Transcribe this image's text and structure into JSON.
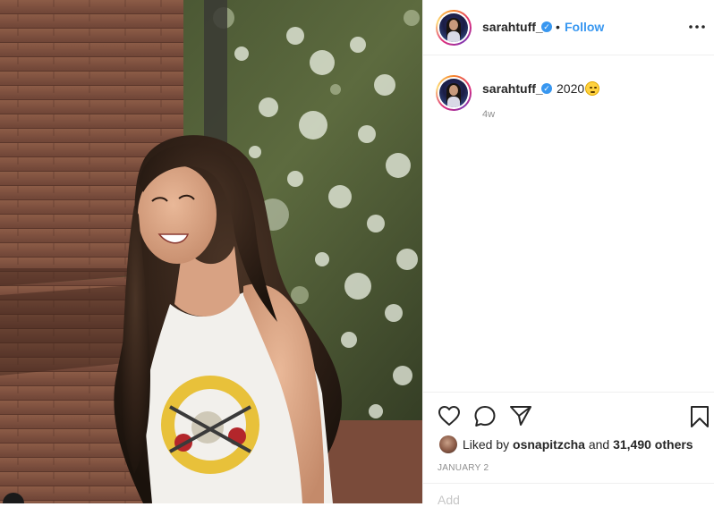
{
  "post": {
    "author": "sarahtuff_",
    "verified": true,
    "follow_label": "Follow",
    "separator": "•",
    "more_icon": "more-horizontal-icon",
    "caption": {
      "author": "sarahtuff_",
      "text": "2020",
      "emoji": "face-emoji",
      "time_ago": "4w"
    },
    "actions": {
      "like_icon": "heart-icon",
      "comment_icon": "comment-icon",
      "share_icon": "paper-plane-icon",
      "save_icon": "bookmark-icon"
    },
    "likes": {
      "prefix": "Liked by",
      "user": "osnapitzcha",
      "joiner": "and",
      "count": "31,490 others"
    },
    "date": "JANUARY 2",
    "comment_stub": "Add"
  },
  "colors": {
    "link_blue": "#3897f0",
    "text": "#262626",
    "muted": "#8e8e8e",
    "divider": "#efefef"
  }
}
